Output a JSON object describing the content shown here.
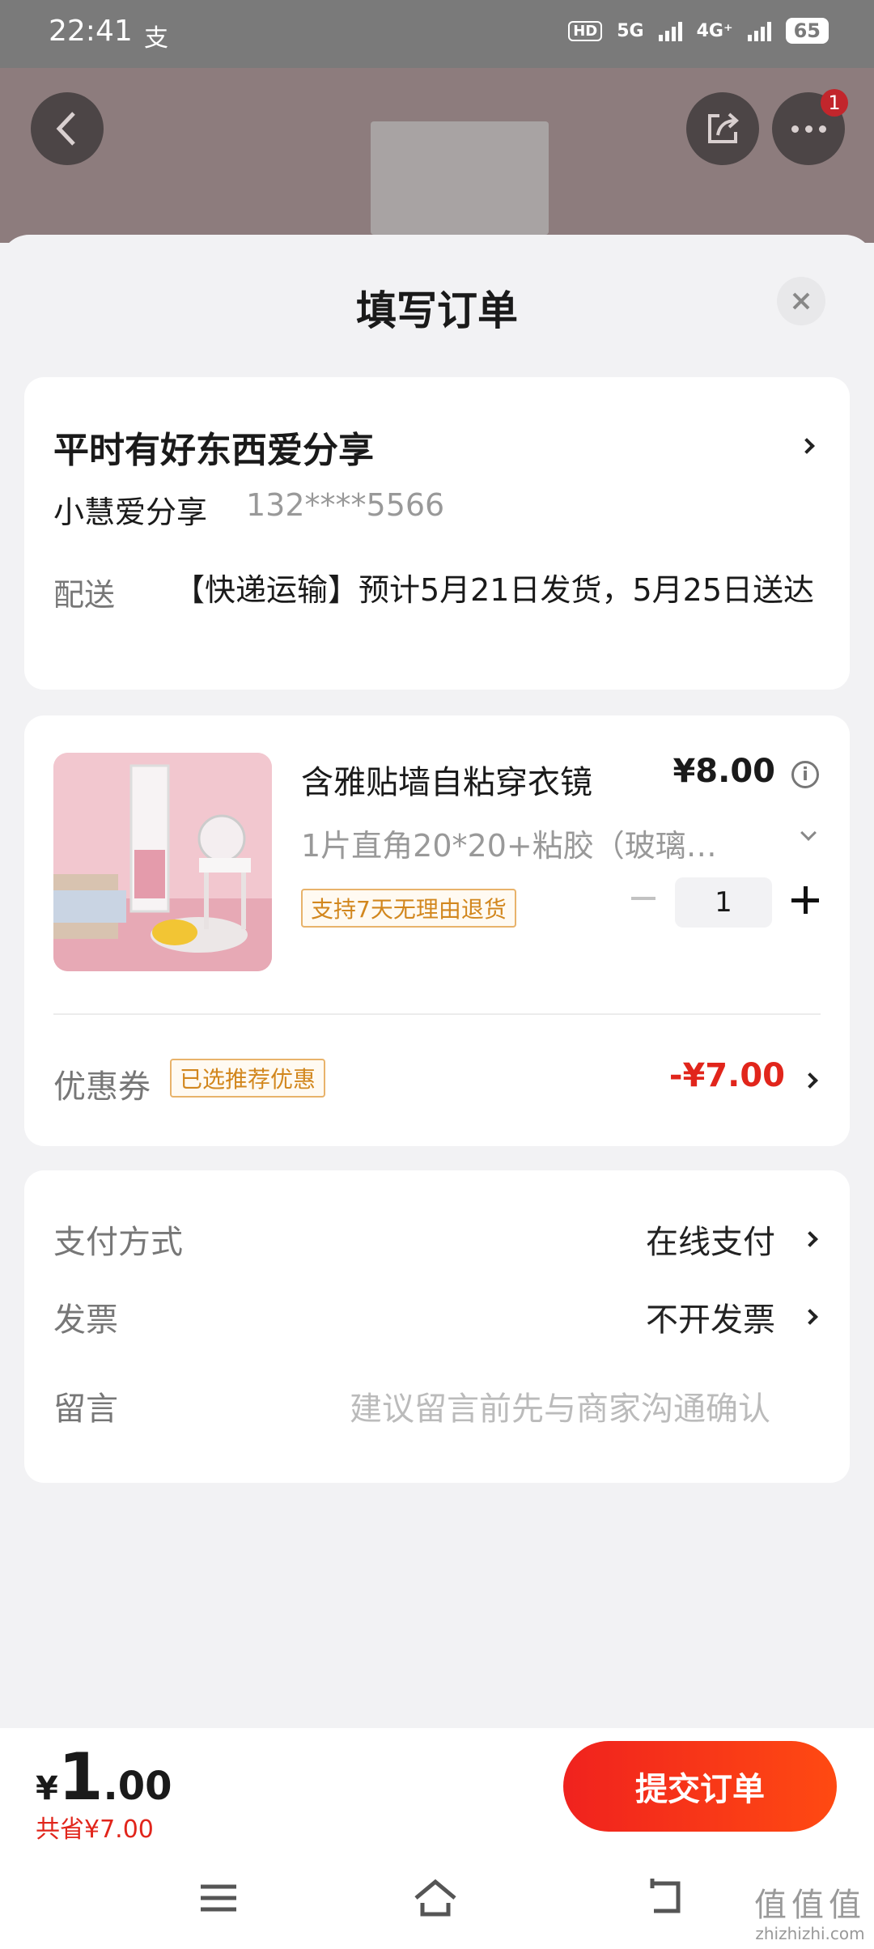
{
  "status_bar": {
    "time": "22:41",
    "extra": "支",
    "network": "HD 5G 4G⁺",
    "battery": "65"
  },
  "background": {
    "notification_count": "1"
  },
  "sheet": {
    "title": "填写订单"
  },
  "address": {
    "title": "平时有好东西爱分享",
    "name": "小慧爱分享",
    "phone": "132****5566",
    "shipping_label": "配送",
    "shipping_text": "【快递运输】预计5月21日发货，5月25日送达"
  },
  "product": {
    "name": "含雅贴墙自粘穿衣镜",
    "price": "¥8.00",
    "spec": "1片直角20*20+粘胶（玻璃…",
    "return_tag": "支持7天无理由退货",
    "quantity": "1",
    "coupon_label": "优惠券",
    "coupon_tag": "已选推荐优惠",
    "coupon_value": "-¥7.00"
  },
  "payment": {
    "method_label": "支付方式",
    "method_value": "在线支付",
    "invoice_label": "发票",
    "invoice_value": "不开发票",
    "message_label": "留言",
    "message_placeholder": "建议留言前先与商家沟通确认"
  },
  "footer": {
    "currency": "¥",
    "total_int": "1",
    "total_dec": ".00",
    "saved": "共省¥7.00",
    "submit_label": "提交订单"
  },
  "watermark": {
    "main": "值值值",
    "sub": "zhizhizhi.com"
  },
  "colors": {
    "accent": "#e1251b",
    "tag": "#d2871e"
  }
}
